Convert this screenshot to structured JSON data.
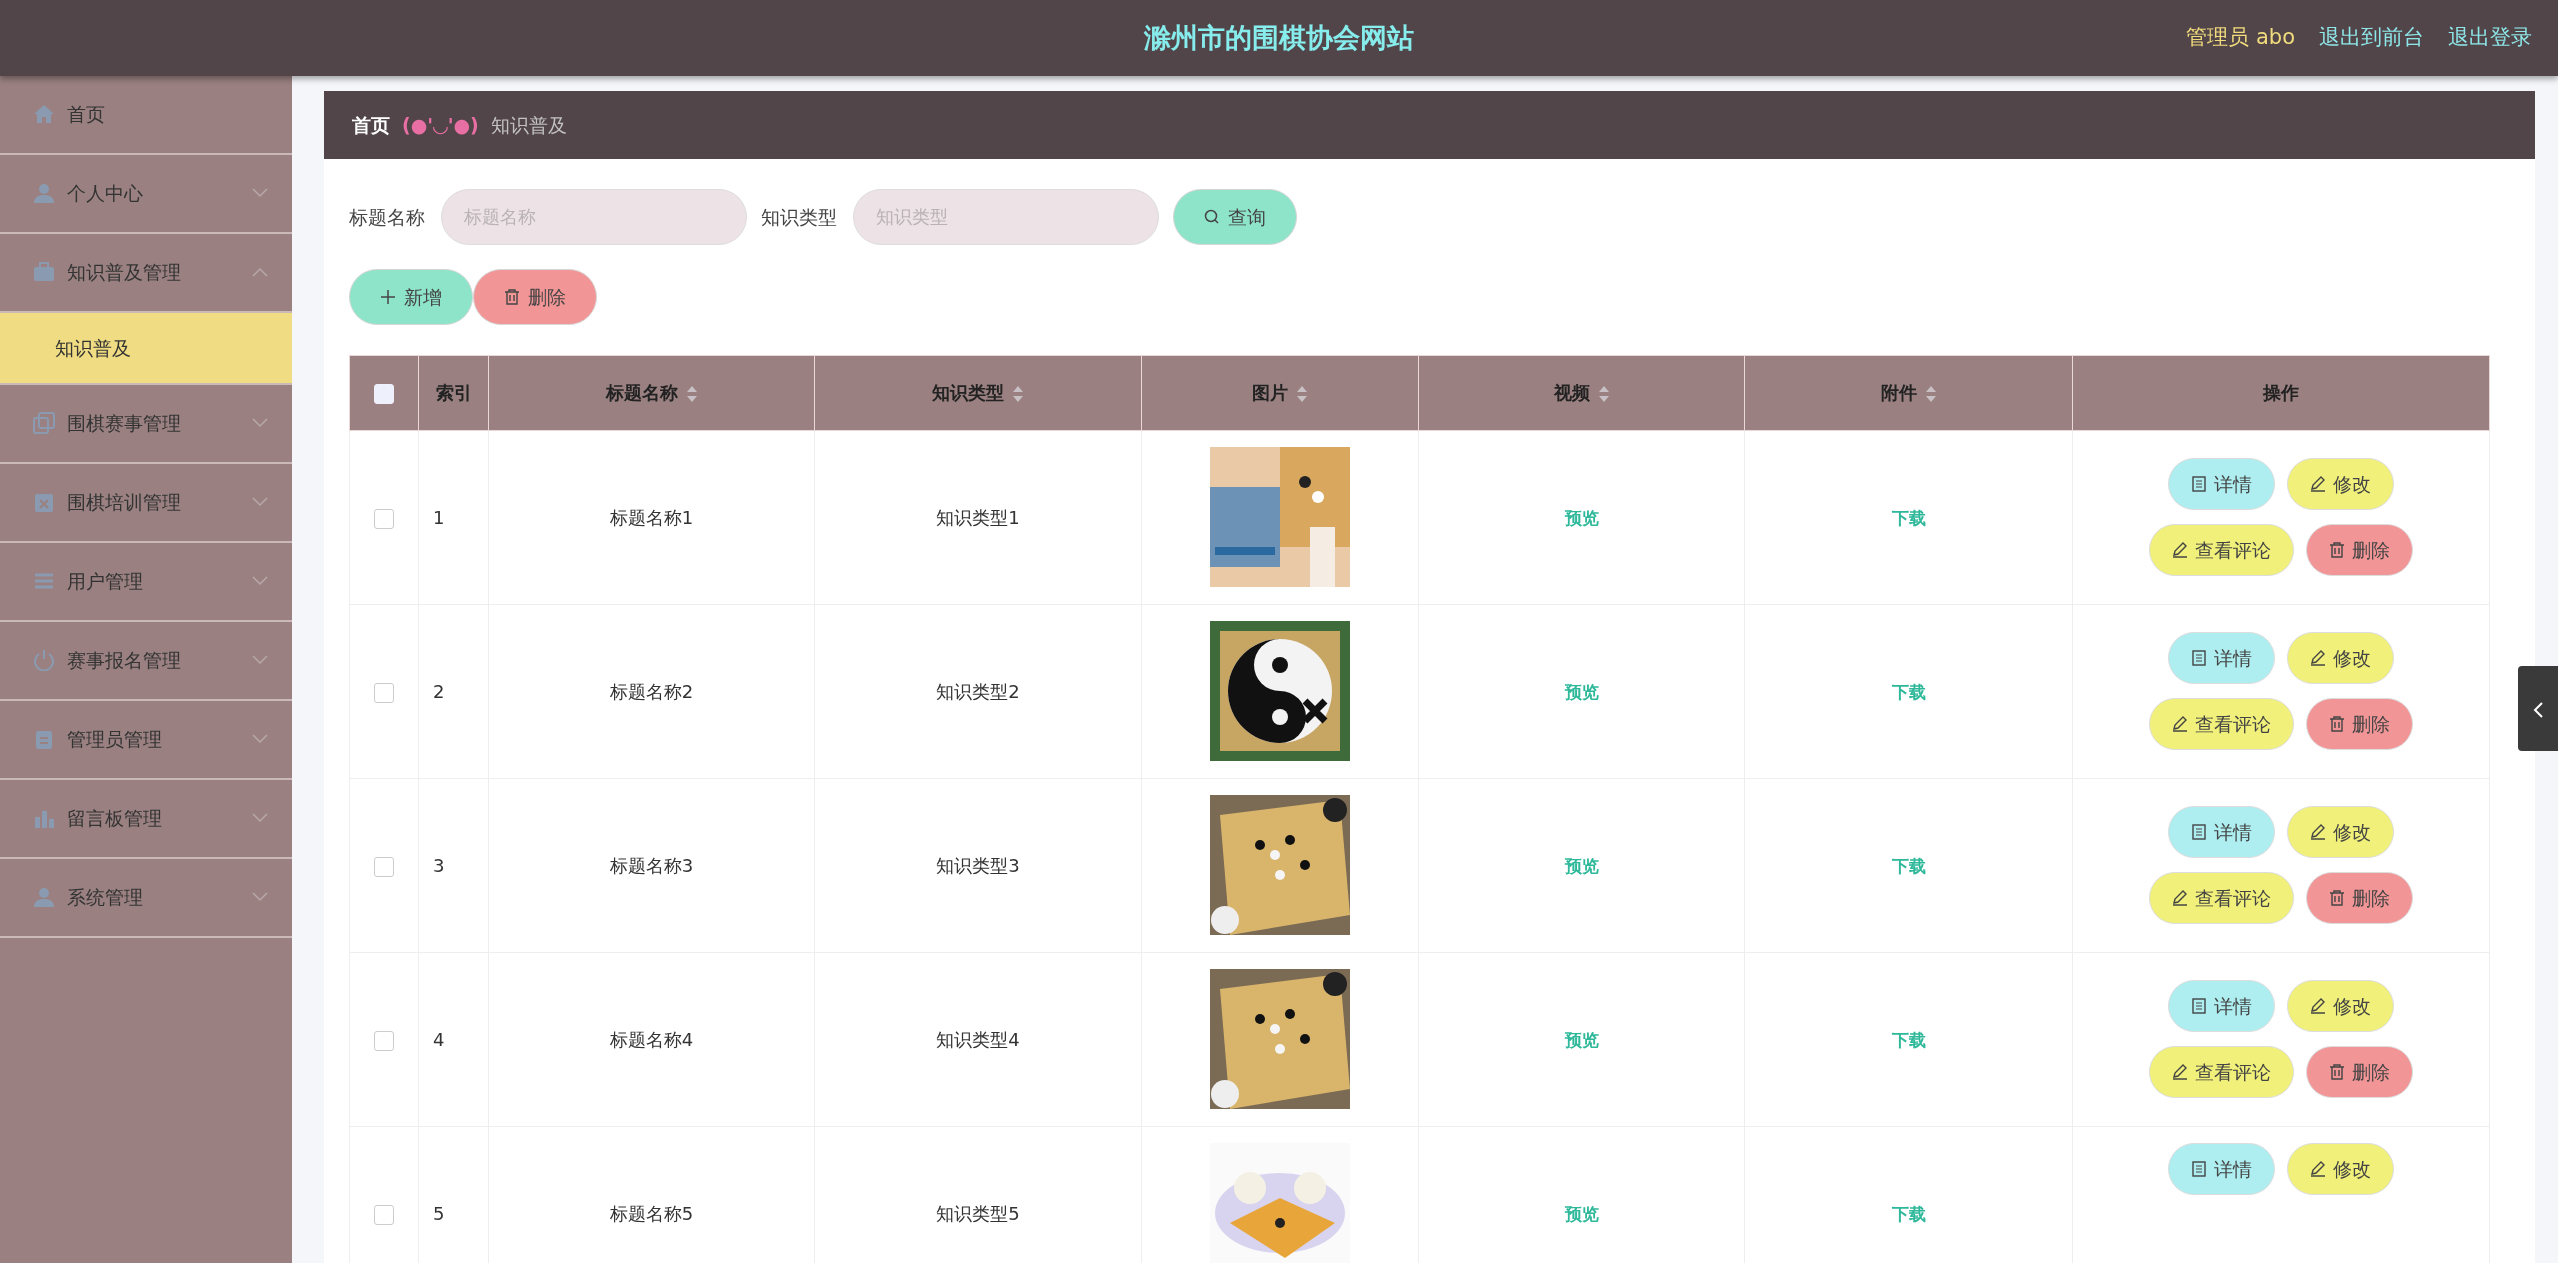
{
  "header": {
    "title": "滁州市的围棋协会网站",
    "user": "管理员 abo",
    "links": [
      "退出到前台",
      "退出登录"
    ]
  },
  "sidebar": {
    "items": [
      {
        "label": "首页",
        "selected": false
      },
      {
        "label": "个人中心",
        "selected": false,
        "expanded": false
      },
      {
        "label": "知识普及管理",
        "selected": false,
        "expanded": true,
        "children": [
          {
            "label": "知识普及",
            "selected": true
          }
        ]
      },
      {
        "label": "围棋赛事管理",
        "selected": false,
        "expanded": false
      },
      {
        "label": "围棋培训管理",
        "selected": false,
        "expanded": false
      },
      {
        "label": "用户管理",
        "selected": false,
        "expanded": false
      },
      {
        "label": "赛事报名管理",
        "selected": false,
        "expanded": false
      },
      {
        "label": "管理员管理",
        "selected": false,
        "expanded": false
      },
      {
        "label": "留言板管理",
        "selected": false,
        "expanded": false
      },
      {
        "label": "系统管理",
        "selected": false,
        "expanded": false
      }
    ]
  },
  "breadcrumb": {
    "home": "首页",
    "separator": "(●'◡'●)",
    "current": "知识普及"
  },
  "search": {
    "fields": [
      {
        "label": "标题名称",
        "placeholder": "标题名称"
      },
      {
        "label": "知识类型",
        "placeholder": "知识类型"
      }
    ],
    "button": "查询"
  },
  "toolbar": [
    {
      "label": "新增",
      "kind": "add"
    },
    {
      "label": "删除",
      "kind": "delete"
    }
  ],
  "table": {
    "columns": [
      {
        "kind": "checkbox",
        "checked": false
      },
      {
        "label": "索引",
        "sortable": false
      },
      {
        "label": "标题名称",
        "sortable": true
      },
      {
        "label": "知识类型",
        "sortable": true
      },
      {
        "label": "图片",
        "sortable": true
      },
      {
        "label": "视频",
        "sortable": true
      },
      {
        "label": "附件",
        "sortable": true
      },
      {
        "label": "操作",
        "sortable": false
      }
    ],
    "rows": [
      {
        "checked": false,
        "index": "1",
        "title": "标题名称1",
        "type": "知识类型1",
        "image": {
          "kind": "picture"
        },
        "video": "预览",
        "attachment": "下载",
        "actions": [
          {
            "label": "详情",
            "kind": "detail"
          },
          {
            "label": "修改",
            "kind": "edit"
          },
          {
            "label": "查看评论",
            "kind": "comment"
          },
          {
            "label": "删除",
            "kind": "delete"
          }
        ]
      },
      {
        "checked": false,
        "index": "2",
        "title": "标题名称2",
        "type": "知识类型2",
        "image": {
          "kind": "picture"
        },
        "video": "预览",
        "attachment": "下载",
        "actions": [
          {
            "label": "详情",
            "kind": "detail"
          },
          {
            "label": "修改",
            "kind": "edit"
          },
          {
            "label": "查看评论",
            "kind": "comment"
          },
          {
            "label": "删除",
            "kind": "delete"
          }
        ]
      },
      {
        "checked": false,
        "index": "3",
        "title": "标题名称3",
        "type": "知识类型3",
        "image": {
          "kind": "picture"
        },
        "video": "预览",
        "attachment": "下载",
        "actions": [
          {
            "label": "详情",
            "kind": "detail"
          },
          {
            "label": "修改",
            "kind": "edit"
          },
          {
            "label": "查看评论",
            "kind": "comment"
          },
          {
            "label": "删除",
            "kind": "delete"
          }
        ]
      },
      {
        "checked": false,
        "index": "4",
        "title": "标题名称4",
        "type": "知识类型4",
        "image": {
          "kind": "picture"
        },
        "video": "预览",
        "attachment": "下载",
        "actions": [
          {
            "label": "详情",
            "kind": "detail"
          },
          {
            "label": "修改",
            "kind": "edit"
          },
          {
            "label": "查看评论",
            "kind": "comment"
          },
          {
            "label": "删除",
            "kind": "delete"
          }
        ]
      },
      {
        "checked": false,
        "index": "5",
        "title": "标题名称5",
        "type": "知识类型5",
        "image": {
          "kind": "picture"
        },
        "video": "预览",
        "attachment": "下载",
        "actions": [
          {
            "label": "详情",
            "kind": "detail"
          },
          {
            "label": "修改",
            "kind": "edit"
          }
        ]
      }
    ]
  }
}
